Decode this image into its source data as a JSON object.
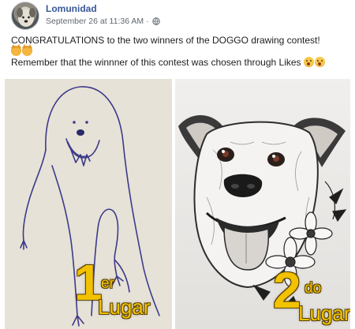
{
  "post": {
    "author": "Lomunidad",
    "timestamp": "September 26 at 11:36 AM",
    "separator": "·",
    "privacy_icon": "globe-icon",
    "line1": "CONGRATULATIONS to the two winners of the DOGGO drawing contest!",
    "line2_emojis": [
      "cat-emoji",
      "cat-emoji"
    ],
    "line3": "Remember that the winnner of this contest was chosen through Likes",
    "line3_emojis": [
      "face-emoji",
      "face-emoji"
    ]
  },
  "images": {
    "first": {
      "number": "1",
      "suffix": "er",
      "word": "Lugar"
    },
    "second": {
      "number": "2",
      "suffix": "do",
      "word": "Lugar"
    }
  },
  "colors": {
    "author": "#385898",
    "meta": "#606770",
    "badge": "#f2c200"
  }
}
